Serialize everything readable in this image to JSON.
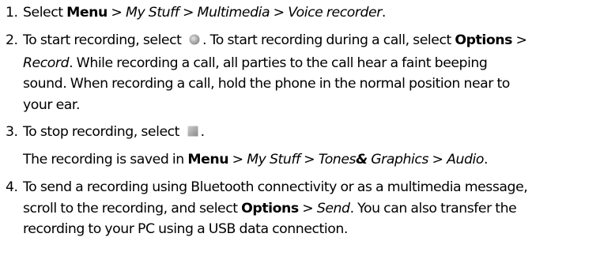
{
  "steps": [
    {
      "number": "1.",
      "text": {
        "prefix": "Select ",
        "menu": "Menu",
        "sep1": " > ",
        "mystuff": "My Stuff",
        "sep2": " > ",
        "multimedia": "Multimedia",
        "sep3": " > ",
        "voicerecorder": "Voice recorder",
        "end": "."
      }
    },
    {
      "number": "2.",
      "lines": {
        "l1_a": "To start recording, select ",
        "l1_b": ". To start recording during a call, select ",
        "l1_options": "Options",
        "l1_c": " >",
        "l2_record": "Record",
        "l2_rest": ". While recording a call, all parties to the call hear a faint beeping",
        "l3": "sound. When recording a call, hold the phone in the normal position near to",
        "l4": "your ear."
      },
      "record_icon": "record-icon"
    },
    {
      "number": "3.",
      "lines": {
        "l1_a": "To stop recording, select ",
        "l1_b": "."
      },
      "stop_icon": "stop-icon"
    },
    {
      "note": {
        "a": "The recording is saved in ",
        "menu": "Menu",
        "sep1": " > ",
        "mystuff": "My Stuff",
        "sep2": " > ",
        "tones": "Tones",
        "amp": "&",
        "graphics": " Graphics",
        "sep3": " > ",
        "audio": "Audio",
        "end": "."
      }
    },
    {
      "number": "4.",
      "lines": {
        "l1": "To send a recording using Bluetooth connectivity or as a multimedia message,",
        "l2_a": "scroll to the recording, and select ",
        "l2_options": "Options",
        "l2_sep": " > ",
        "l2_send": "Send",
        "l2_b": ". You can also transfer the",
        "l3": "recording to your PC using a USB data connection."
      }
    }
  ]
}
